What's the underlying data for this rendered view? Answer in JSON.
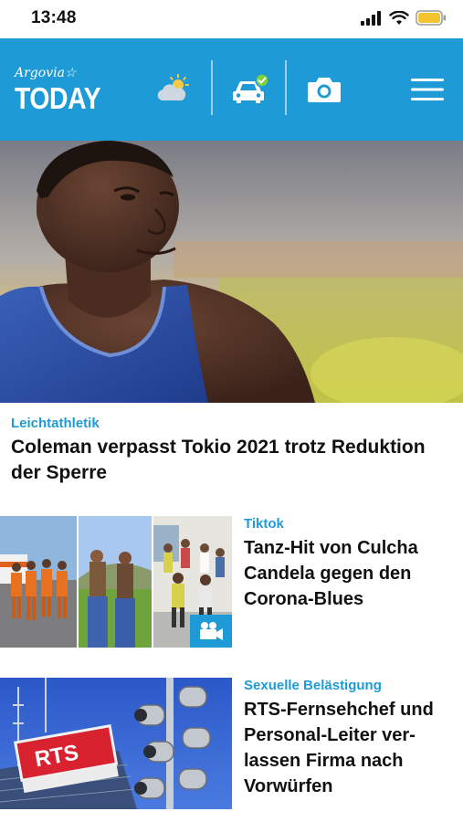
{
  "status_bar": {
    "time": "13:48"
  },
  "header": {
    "logo_top": "Argovia☆",
    "logo_main": "TODAY",
    "icons": [
      "weather-icon",
      "traffic-car-icon",
      "camera-icon",
      "hamburger-menu-icon"
    ],
    "brand_color": "#1e9bd7"
  },
  "hero": {
    "kicker": "Leichtathletik",
    "title": "Coleman verpasst Tokio 2021 trotz Reduktion der Sperre"
  },
  "articles": [
    {
      "kicker": "Tiktok",
      "title": "Tanz-Hit von Culcha Candela gegen den Corona-Blues",
      "has_video": true
    },
    {
      "kicker": "Sexuelle Belästigung",
      "title": "RTS-Fernsehchef und Personal-Leiter ver-lassen Firma nach Vorwürfen",
      "image_sign_text": "RTS"
    }
  ]
}
